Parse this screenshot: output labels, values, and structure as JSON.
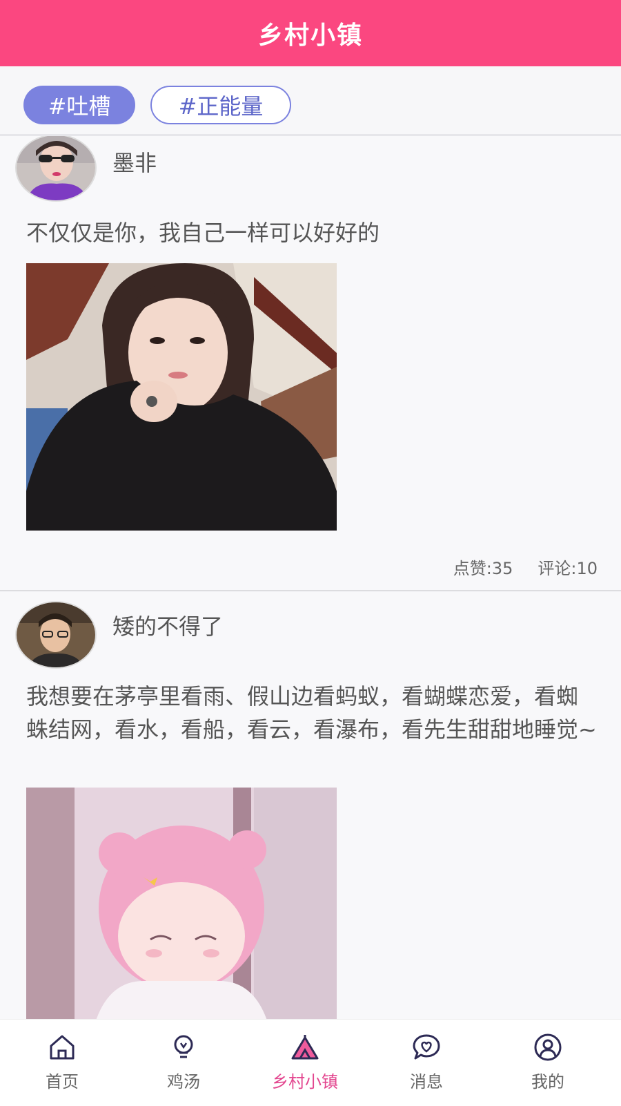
{
  "header": {
    "title": "乡村小镇"
  },
  "tags": [
    {
      "label": "#吐槽",
      "active": true
    },
    {
      "label": "#正能量",
      "active": false
    }
  ],
  "posts": [
    {
      "username": "墨非",
      "content": "不仅仅是你，我自己一样可以好好的",
      "likes_label": "点赞:35",
      "comments_label": "评论:10"
    },
    {
      "username": "矮的不得了",
      "content": "我想要在茅亭里看雨、假山边看蚂蚁，看蝴蝶恋爱，看蜘蛛结网，看水，看船，看云，看瀑布，看先生甜甜地睡觉~"
    }
  ],
  "tabbar": {
    "items": [
      {
        "label": "首页",
        "icon": "home-icon"
      },
      {
        "label": "鸡汤",
        "icon": "lightbulb-icon"
      },
      {
        "label": "乡村小镇",
        "icon": "tent-icon",
        "active": true
      },
      {
        "label": "消息",
        "icon": "heart-chat-icon"
      },
      {
        "label": "我的",
        "icon": "user-icon"
      }
    ],
    "active_color": "#e3468f"
  },
  "colors": {
    "header": "#fb4780",
    "tag_accent": "#7b82df"
  }
}
